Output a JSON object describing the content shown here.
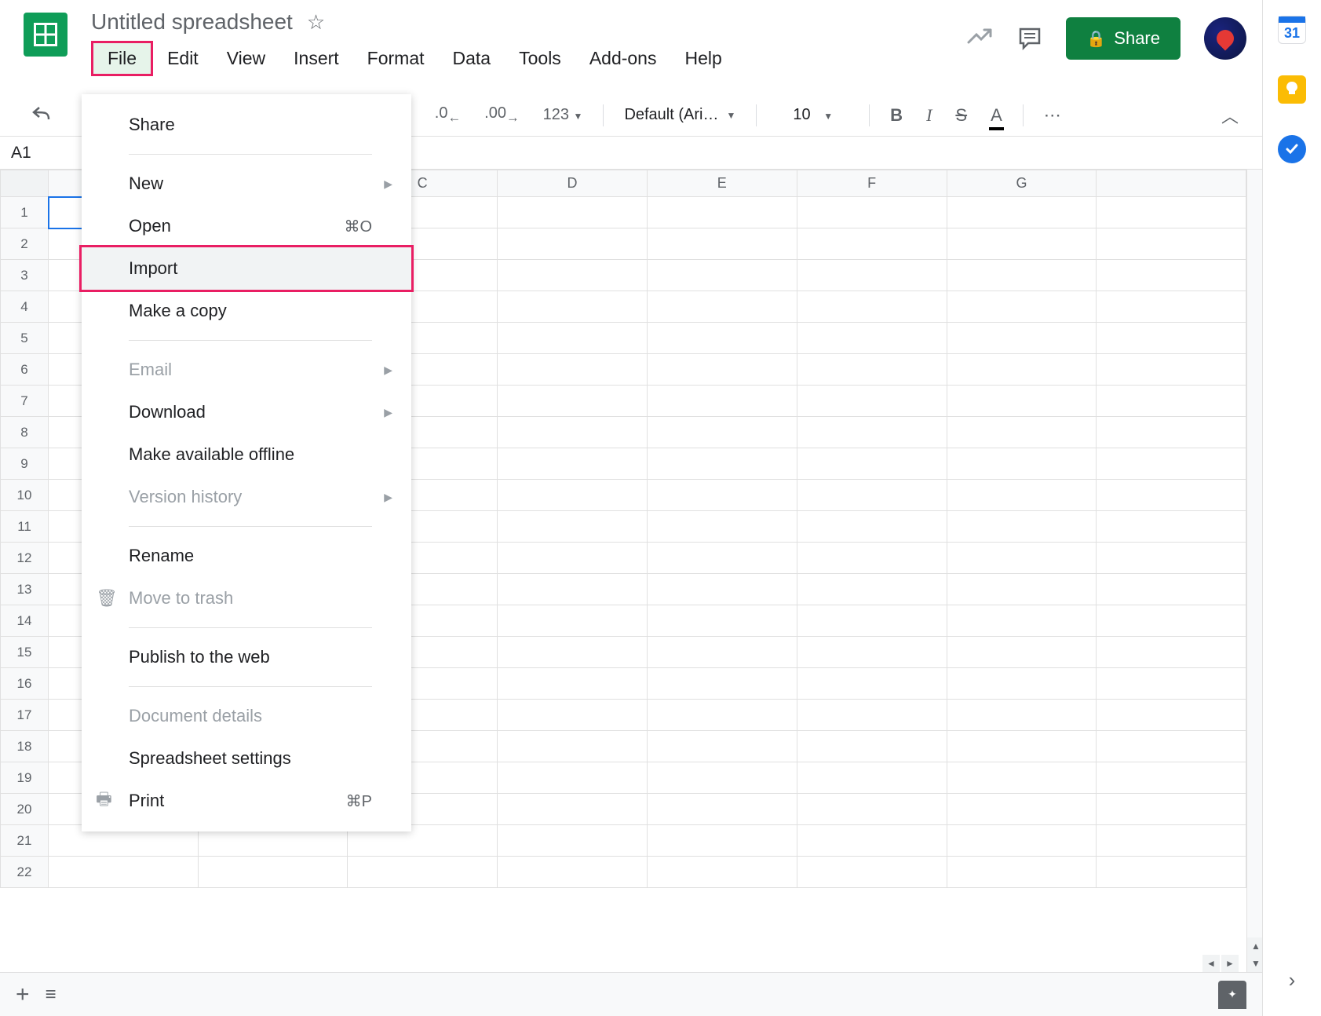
{
  "doc": {
    "title": "Untitled spreadsheet"
  },
  "menubar": [
    "File",
    "Edit",
    "View",
    "Insert",
    "Format",
    "Data",
    "Tools",
    "Add-ons",
    "Help"
  ],
  "header": {
    "share": "Share"
  },
  "toolbar": {
    "percent": "%",
    "dec1": ".0",
    "dec2": ".00",
    "format123": "123",
    "font": "Default (Ari…",
    "font_size": "10",
    "more": "⋯"
  },
  "cell_ref": "A1",
  "columns": [
    "",
    "",
    "C",
    "D",
    "E",
    "F",
    "G",
    ""
  ],
  "rows": [
    "1",
    "2",
    "3",
    "4",
    "5",
    "6",
    "7",
    "8",
    "9",
    "10",
    "11",
    "12",
    "13",
    "14",
    "15",
    "16",
    "17",
    "18",
    "19",
    "20",
    "21",
    "22"
  ],
  "file_menu": [
    {
      "label": "Share",
      "type": "item"
    },
    {
      "type": "divider"
    },
    {
      "label": "New",
      "type": "submenu"
    },
    {
      "label": "Open",
      "shortcut": "⌘O",
      "type": "item"
    },
    {
      "label": "Import",
      "type": "item",
      "highlighted": true
    },
    {
      "label": "Make a copy",
      "type": "item"
    },
    {
      "type": "divider"
    },
    {
      "label": "Email",
      "type": "submenu",
      "disabled": true
    },
    {
      "label": "Download",
      "type": "submenu"
    },
    {
      "label": "Make available offline",
      "type": "item"
    },
    {
      "label": "Version history",
      "type": "submenu",
      "disabled": true
    },
    {
      "type": "divider"
    },
    {
      "label": "Rename",
      "type": "item"
    },
    {
      "label": "Move to trash",
      "type": "item",
      "disabled": true,
      "icon": "trash"
    },
    {
      "type": "divider"
    },
    {
      "label": "Publish to the web",
      "type": "item"
    },
    {
      "type": "divider"
    },
    {
      "label": "Document details",
      "type": "item",
      "disabled": true
    },
    {
      "label": "Spreadsheet settings",
      "type": "item"
    },
    {
      "label": "Print",
      "shortcut": "⌘P",
      "type": "item",
      "icon": "print"
    }
  ],
  "sidepanel": {
    "cal_day": "31"
  }
}
